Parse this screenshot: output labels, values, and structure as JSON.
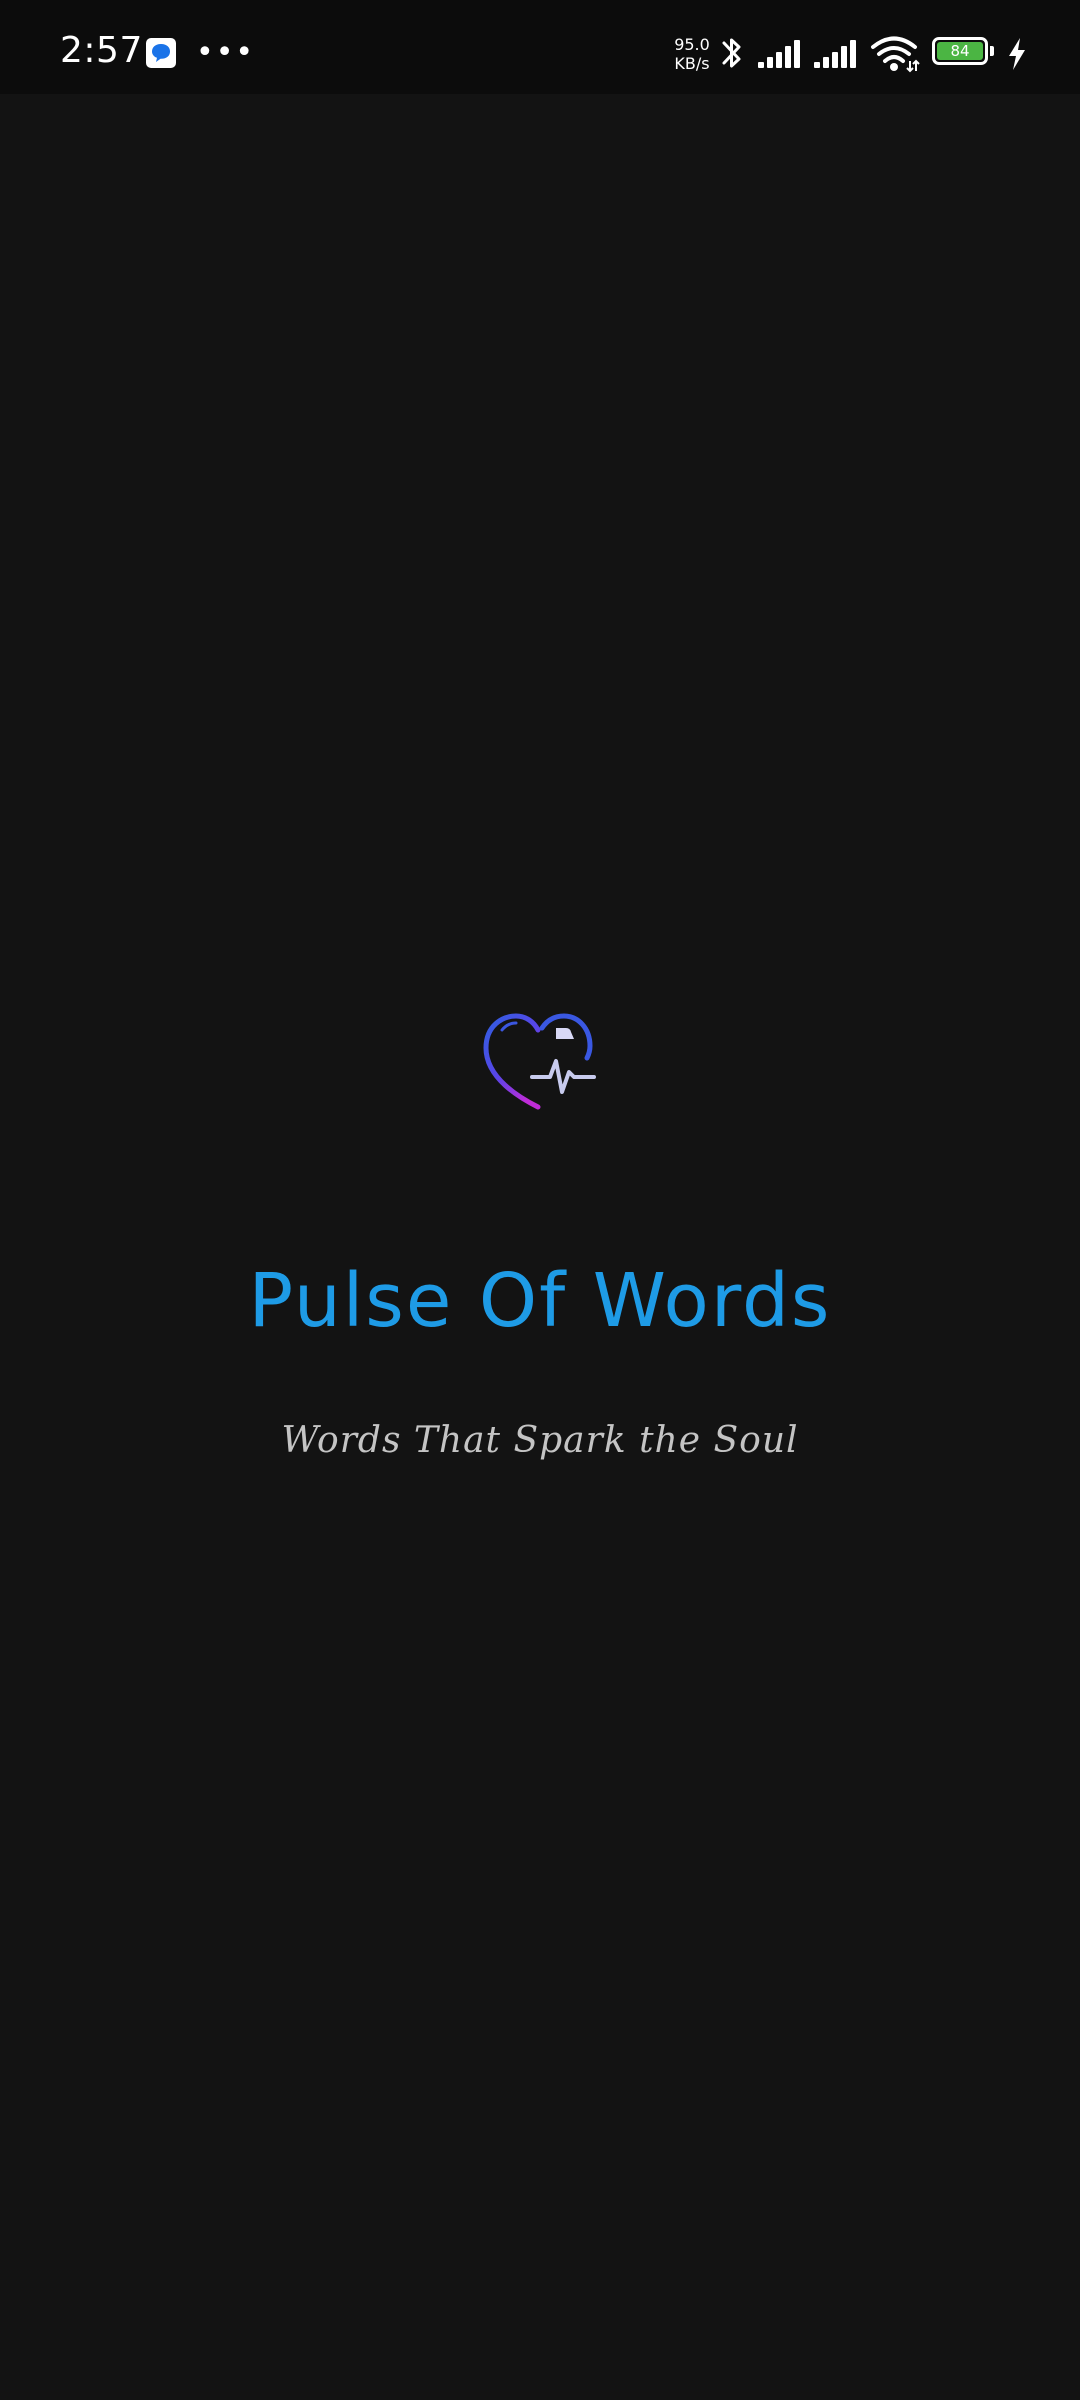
{
  "status_bar": {
    "time": "2:57",
    "more": "•••",
    "net_speed_value": "95.0",
    "net_speed_unit": "KB/s",
    "battery_level": "84",
    "icons": [
      "messages-icon",
      "bluetooth-icon",
      "signal-icon",
      "signal-icon",
      "wifi-icon",
      "battery-icon",
      "charging-icon"
    ]
  },
  "splash": {
    "title": "Pulse Of Words",
    "tagline": "Words That Spark the Soul"
  },
  "colors": {
    "background": "#131313",
    "title": "#1e9be6",
    "tagline": "#c4c4c4",
    "battery": "#4bb543"
  }
}
